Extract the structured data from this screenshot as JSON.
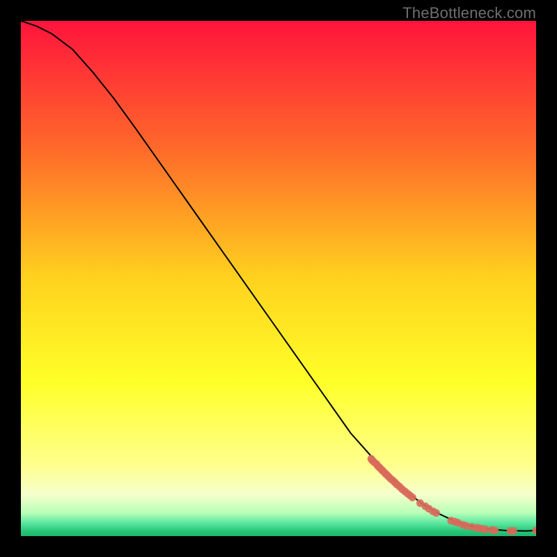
{
  "watermark": "TheBottleneck.com",
  "chart_data": {
    "type": "line",
    "title": "",
    "xlabel": "",
    "ylabel": "",
    "xlim": [
      0,
      100
    ],
    "ylim": [
      0,
      100
    ],
    "grid": false,
    "legend": false,
    "gradient_stops": [
      {
        "offset": 0.0,
        "color": "#ff143c"
      },
      {
        "offset": 0.25,
        "color": "#ff6a2a"
      },
      {
        "offset": 0.5,
        "color": "#ffd21e"
      },
      {
        "offset": 0.7,
        "color": "#ffff28"
      },
      {
        "offset": 0.86,
        "color": "#ffff8c"
      },
      {
        "offset": 0.92,
        "color": "#f5ffcc"
      },
      {
        "offset": 0.955,
        "color": "#b8ffb8"
      },
      {
        "offset": 0.975,
        "color": "#5ae6a0"
      },
      {
        "offset": 0.99,
        "color": "#28c878"
      },
      {
        "offset": 1.0,
        "color": "#1eb46e"
      }
    ],
    "series": [
      {
        "name": "curve",
        "style": "line",
        "color": "#000000",
        "x": [
          0,
          3,
          6,
          10,
          14,
          18,
          22,
          28,
          34,
          40,
          46,
          52,
          58,
          64,
          68,
          72,
          75,
          78,
          81,
          84,
          87,
          90,
          94,
          98,
          100
        ],
        "y": [
          100,
          99,
          97.5,
          94.5,
          90,
          85,
          79.5,
          71,
          62.5,
          54,
          45.5,
          37,
          28.5,
          20,
          15.5,
          11.5,
          8.5,
          6.2,
          4.4,
          3.0,
          2.0,
          1.4,
          1.1,
          1.0,
          1.1
        ]
      },
      {
        "name": "dense-points",
        "style": "scatter",
        "color": "#d86a5a",
        "x": [
          68.0,
          68.2,
          68.5,
          69.0,
          69.3,
          69.6,
          70.0,
          70.3,
          70.7,
          71.0,
          71.4,
          71.8,
          72.2,
          72.6,
          73.0,
          73.5,
          74.0,
          74.5,
          75.0,
          75.5,
          76.0
        ],
        "y": [
          15.0,
          14.7,
          14.4,
          14.0,
          13.6,
          13.3,
          12.9,
          12.6,
          12.2,
          11.9,
          11.5,
          11.1,
          10.8,
          10.4,
          10.0,
          9.6,
          9.1,
          8.7,
          8.3,
          7.9,
          7.5
        ]
      },
      {
        "name": "sparse-points",
        "style": "scatter",
        "color": "#d86a5a",
        "x": [
          77.5,
          78.5,
          79.2,
          80.0,
          80.6,
          83.5,
          84.2,
          84.8,
          85.8,
          86.4,
          87.5,
          88.5,
          89.0,
          89.7,
          90.2,
          91.5,
          92.0,
          95.0,
          95.6,
          100.0
        ],
        "y": [
          6.4,
          5.8,
          5.3,
          4.8,
          4.5,
          3.0,
          2.8,
          2.6,
          2.2,
          2.0,
          1.8,
          1.6,
          1.5,
          1.4,
          1.3,
          1.2,
          1.1,
          1.0,
          1.0,
          1.1
        ]
      }
    ]
  }
}
